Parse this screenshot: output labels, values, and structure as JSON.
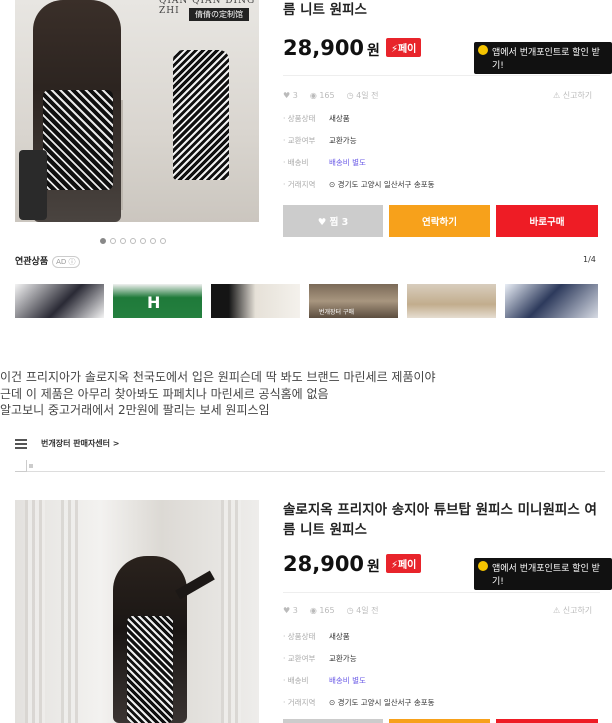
{
  "listing_top": {
    "image": {
      "brand_top": "QIAN QIAN DING ZHI",
      "brand_tag": "倩倩の定制馆"
    },
    "carousel": {
      "dot_count": 7,
      "active_index": 0
    },
    "title_line": "름 니트 원피스",
    "price": "28,900",
    "price_unit": "원",
    "pay_badge": "⚡페이",
    "app_banner": "앱에서 번개포인트로 할인 받기!",
    "stats": {
      "likes": "3",
      "views": "165",
      "time": "4일 전"
    },
    "report": "신고하기",
    "info": [
      {
        "key": "상품상태",
        "value": "새상품"
      },
      {
        "key": "교환여부",
        "value": "교환가능"
      },
      {
        "key": "배송비",
        "value": "배송비 별도"
      },
      {
        "key": "거래지역",
        "value": "경기도 고양시 일산서구 송포동"
      }
    ],
    "buttons": {
      "like": "♥ 찜 3",
      "contact": "연락하기",
      "buy": "바로구매"
    },
    "related": {
      "label": "연관상품",
      "ad": "AD ⓘ",
      "pager": "1/4",
      "thumb_caption": "번개장터 구매"
    }
  },
  "post_text": [
    "이건 프리지아가 솔로지옥 천국도에서 입은 원피슨데 딱 봐도 브랜드 마린세르 제품이야",
    "근데 이 제품은 아무리 찾아봐도 파페치나 마린세르 공식홈에 없음",
    "알고보니 중고거래에서 2만원에 팔리는 보세 원피스임"
  ],
  "listing_bottom": {
    "nav_label": "번개장터 판매자센터 >",
    "title_line1": "솔로지옥 프리지아 송지아 튜브탑 원피스 미니원피스 여",
    "title_line2": "름 니트 원피스",
    "price": "28,900",
    "price_unit": "원",
    "pay_badge": "⚡페이",
    "app_banner": "앱에서 번개포인트로 할인 받기!",
    "stats": {
      "likes": "3",
      "views": "165",
      "time": "4일 전"
    },
    "report": "신고하기",
    "info": [
      {
        "key": "상품상태",
        "value": "새상품"
      },
      {
        "key": "교환여부",
        "value": "교환가능"
      },
      {
        "key": "배송비",
        "value": "배송비 별도"
      },
      {
        "key": "거래지역",
        "value": "경기도 고양시 일산서구 송포동"
      }
    ]
  },
  "colors": {
    "pay_red": "#e8242b",
    "contact_orange": "#f7a11b",
    "buy_red": "#ee1c25",
    "like_gray": "#cccccc",
    "shipping_purple": "#6c5ce7"
  }
}
